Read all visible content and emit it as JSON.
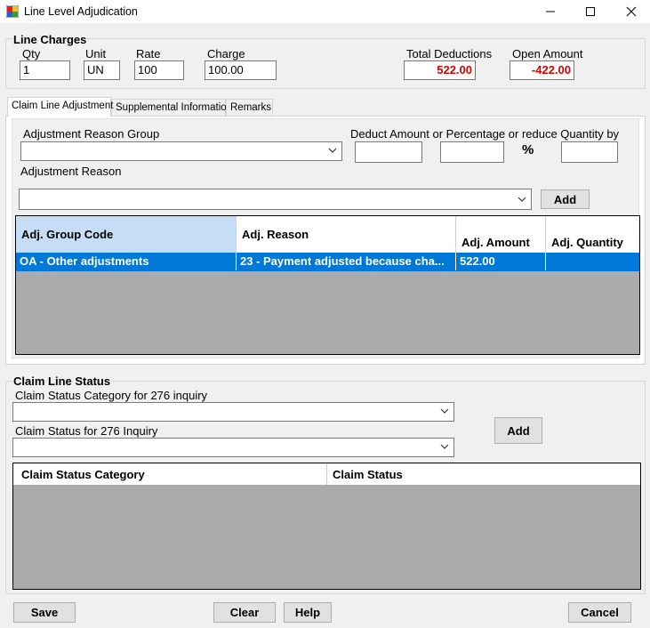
{
  "window": {
    "title": "Line Level Adjudication",
    "minimize_icon": "minimize-icon",
    "maximize_icon": "maximize-icon",
    "close_icon": "close-icon"
  },
  "line_charges": {
    "title": "Line Charges",
    "qty_label": "Qty",
    "qty_value": "1",
    "unit_label": "Unit",
    "unit_value": "UN",
    "rate_label": "Rate",
    "rate_value": "100",
    "charge_label": "Charge",
    "charge_value": "100.00",
    "total_deductions_label": "Total Deductions",
    "total_deductions_value": "522.00",
    "open_amount_label": "Open Amount",
    "open_amount_value": "-422.00"
  },
  "tabs": [
    {
      "label": "Claim Line Adjustment",
      "active": true
    },
    {
      "label": "Supplemental Information",
      "active": false
    },
    {
      "label": "Remarks",
      "active": false
    }
  ],
  "adjustment": {
    "reason_group_label": "Adjustment Reason Group",
    "reason_group_value": "",
    "deduct_label": "Deduct Amount or Percentage or reduce Quantity by",
    "deduct_amount_value": "",
    "deduct_percent_value": "",
    "percent_symbol": "%",
    "reduce_quantity_value": "",
    "reason_label": "Adjustment Reason",
    "reason_value": "",
    "add_label": "Add",
    "columns": [
      "Adj. Group Code",
      "Adj. Reason",
      "Adj. Amount",
      "Adj. Quantity"
    ],
    "rows": [
      {
        "group_code": "OA - Other adjustments",
        "reason": "23 - Payment adjusted because cha...",
        "amount": "522.00",
        "quantity": ""
      }
    ]
  },
  "claim_line_status": {
    "title": "Claim Line Status",
    "category_label": "Claim Status Category for 276 inquiry",
    "category_value": "",
    "status_label": "Claim Status for 276 Inquiry",
    "status_value": "",
    "add_label": "Add",
    "columns": [
      "Claim Status Category",
      "Claim Status"
    ]
  },
  "footer": {
    "save_label": "Save",
    "clear_label": "Clear",
    "help_label": "Help",
    "cancel_label": "Cancel"
  },
  "colors": {
    "selection": "#0078d7",
    "header_selected": "#c5def5",
    "negative_red": "#d40000",
    "grid_empty": "#ababab"
  }
}
